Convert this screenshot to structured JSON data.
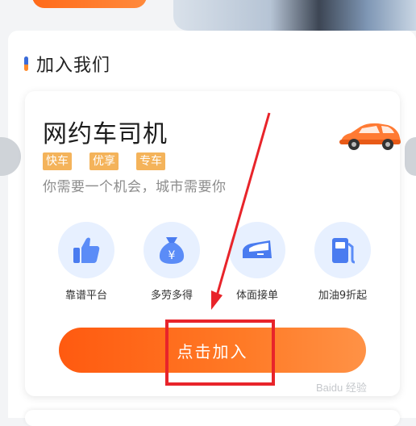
{
  "section": {
    "title": "加入我们"
  },
  "card": {
    "title": "网约车司机",
    "tags": [
      "快车",
      "优享",
      "专车"
    ],
    "subtitle": "你需要一个机会，城市需要你"
  },
  "features": [
    {
      "label": "靠谱平台",
      "icon": "thumbs-up-icon"
    },
    {
      "label": "多劳多得",
      "icon": "money-bag-icon"
    },
    {
      "label": "体面接单",
      "icon": "car-door-icon"
    },
    {
      "label": "加油9折起",
      "icon": "fuel-pump-icon"
    }
  ],
  "join_button": {
    "label": "点击加入"
  },
  "watermark": {
    "text": "Baidu 经验"
  },
  "colors": {
    "accent": "#ff6a1a",
    "tag": "#f4b35a",
    "icon_blue": "#4a7cf0",
    "annotation": "#e8242a"
  }
}
